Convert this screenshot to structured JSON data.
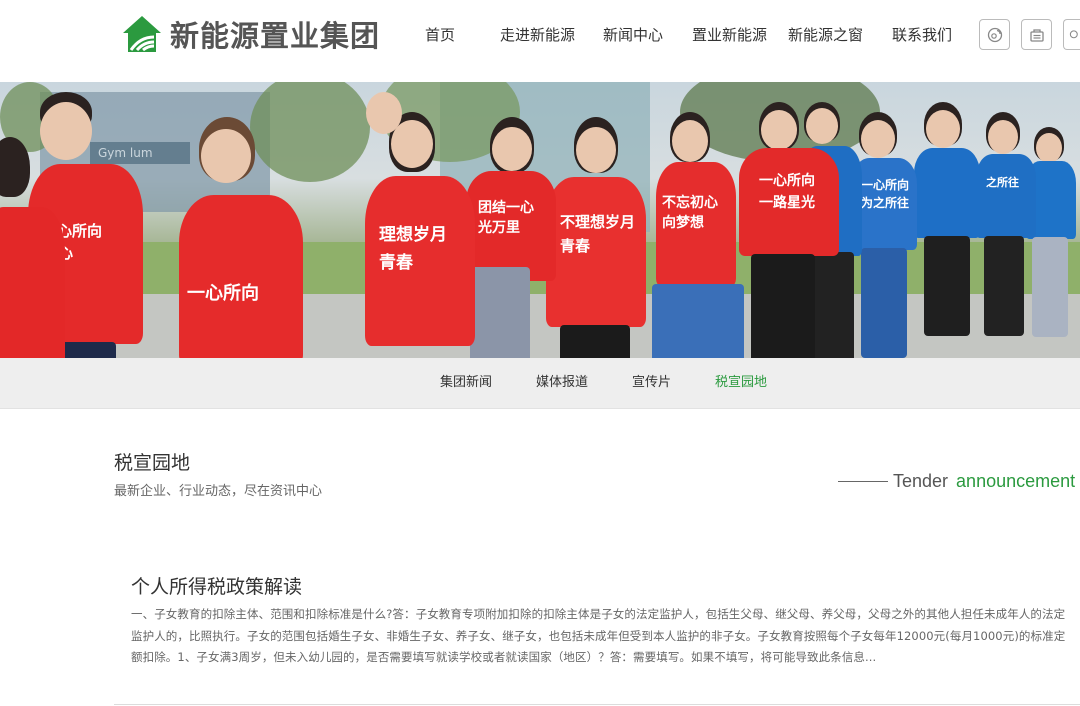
{
  "brand": {
    "name": "新能源置业集团",
    "green": "#2b9a3f",
    "gray": "#555555"
  },
  "nav": {
    "items": [
      "首页",
      "走进新能源",
      "新闻中心",
      "置业新能源",
      "新能源之窗",
      "联系我们"
    ]
  },
  "header_icons": [
    "weibo-icon",
    "wechat-icon",
    "search-icon"
  ],
  "banner": {
    "sign": "Gym   lum",
    "shirts": [
      "一心所向",
      "心",
      "理想岁月",
      "青春",
      "团结一心",
      "光万里",
      "不理想岁月",
      "青春",
      "一心所向",
      "一路星光",
      "不忘初心",
      "向梦想",
      "一心所向",
      "为之所往",
      "一心所向",
      "之所往"
    ]
  },
  "subnav": {
    "items": [
      "集团新闻",
      "媒体报道",
      "宣传片",
      "税宣园地"
    ],
    "active_index": 3
  },
  "section": {
    "title": "税宣园地",
    "subtitle": "最新企业、行业动态，尽在资讯中心",
    "tender_word": "Tender",
    "tender_green": "announcement"
  },
  "article": {
    "title": "个人所得税政策解读",
    "body": "一、子女教育的扣除主体、范围和扣除标准是什么?答：子女教育专项附加扣除的扣除主体是子女的法定监护人，包括生父母、继父母、养父母，父母之外的其他人担任未成年人的法定监护人的，比照执行。子女的范围包括婚生子女、非婚生子女、养子女、继子女，也包括未成年但受到本人监护的非子女。子女教育按照每个子女每年12000元(每月1000元)的标准定额扣除。1、子女满3周岁，但未入幼儿园的，是否需要填写就读学校或者就读国家（地区）？答：需要填写。如果不填写，将可能导致此条信息..."
  }
}
